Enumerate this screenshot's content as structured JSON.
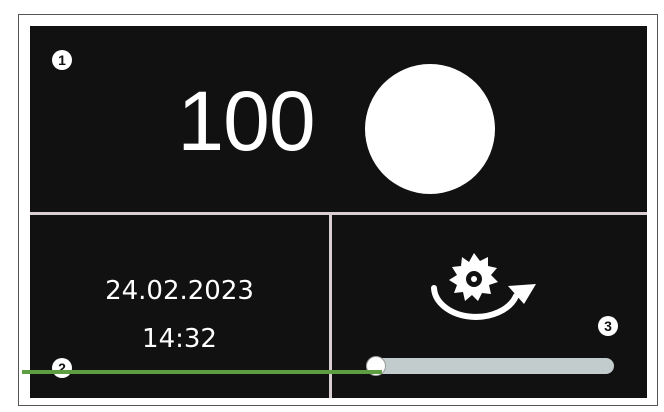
{
  "display": {
    "top_value": "100",
    "date": "24.02.2023",
    "time": "14:32",
    "slider_level_fraction": 0.0
  },
  "callouts": {
    "one": "1",
    "two": "2",
    "three": "3"
  },
  "icons": {
    "status_indicator": "filled-circle",
    "saw_rotation": "saw-blade-rotate-icon"
  },
  "colors": {
    "screen_background": "#111111",
    "divider": "#d9cfd2",
    "slider_track": "#c3cccc",
    "indicator": "#ffffff",
    "bottom_bar": "#5f9d43"
  }
}
